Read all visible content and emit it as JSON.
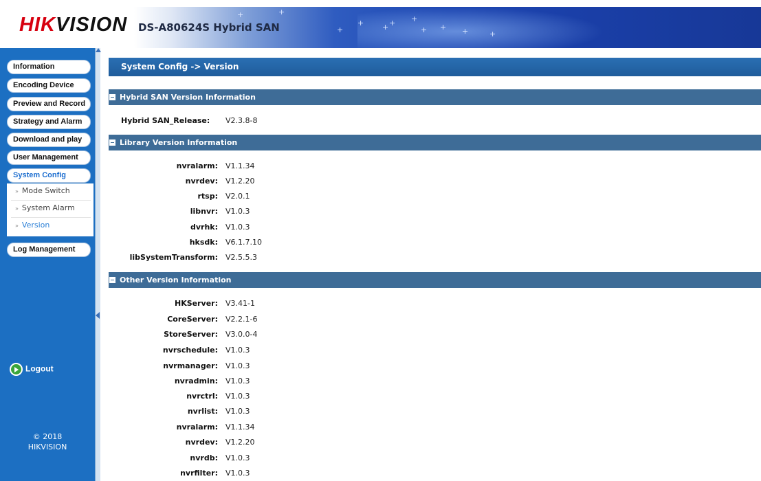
{
  "header": {
    "logo_text_a": "HIK",
    "logo_text_b": "VISION",
    "product": "DS-A80624S Hybrid SAN"
  },
  "sidebar": {
    "items": [
      {
        "label": "Information"
      },
      {
        "label": "Encoding Device"
      },
      {
        "label": "Preview and Record"
      },
      {
        "label": "Strategy and Alarm"
      },
      {
        "label": "Download and play"
      },
      {
        "label": "User Management"
      },
      {
        "label": "System Config",
        "active": true
      },
      {
        "label": "Log Management"
      }
    ],
    "subitems": [
      {
        "label": "Mode Switch"
      },
      {
        "label": "System Alarm"
      },
      {
        "label": "Version",
        "active": true
      }
    ],
    "logout_label": "Logout",
    "copyright_line1": "© 2018",
    "copyright_line2": "HIKVISION"
  },
  "main": {
    "breadcrumb": "System Config -> Version",
    "sections": [
      {
        "title": "Hybrid SAN Version Information",
        "rows": [
          {
            "label": "Hybrid SAN_Release:",
            "value": "V2.3.8-8"
          }
        ]
      },
      {
        "title": "Library Version Information",
        "rows": [
          {
            "label": "nvralarm:",
            "value": "V1.1.34"
          },
          {
            "label": "nvrdev:",
            "value": "V1.2.20"
          },
          {
            "label": "rtsp:",
            "value": "V2.0.1"
          },
          {
            "label": "libnvr:",
            "value": "V1.0.3"
          },
          {
            "label": "dvrhk:",
            "value": "V1.0.3"
          },
          {
            "label": "hksdk:",
            "value": "V6.1.7.10"
          },
          {
            "label": "libSystemTransform:",
            "value": "V2.5.5.3"
          }
        ]
      },
      {
        "title": "Other Version Information",
        "rows": [
          {
            "label": "HKServer:",
            "value": "V3.41-1"
          },
          {
            "label": "CoreServer:",
            "value": "V2.2.1-6"
          },
          {
            "label": "StoreServer:",
            "value": "V3.0.0-4"
          },
          {
            "label": "nvrschedule:",
            "value": "V1.0.3"
          },
          {
            "label": "nvrmanager:",
            "value": "V1.0.3"
          },
          {
            "label": "nvradmin:",
            "value": "V1.0.3"
          },
          {
            "label": "nvrctrl:",
            "value": "V1.0.3"
          },
          {
            "label": "nvrlist:",
            "value": "V1.0.3"
          },
          {
            "label": "nvralarm:",
            "value": "V1.1.34"
          },
          {
            "label": "nvrdev:",
            "value": "V1.2.20"
          },
          {
            "label": "nvrdb:",
            "value": "V1.0.3"
          },
          {
            "label": "nvrfilter:",
            "value": "V1.0.3"
          }
        ]
      }
    ]
  },
  "colors": {
    "sidebar_bg": "#1c6fc2",
    "title_bar": "#1f5c9b",
    "section_bar": "#3e6c97",
    "brand_red": "#d7000f",
    "active_link": "#2a7fd6"
  },
  "icons": {
    "logout": "arrow-right-circle-icon",
    "section": "minus-box-icon",
    "subnav": "double-chevron-right-icon"
  }
}
